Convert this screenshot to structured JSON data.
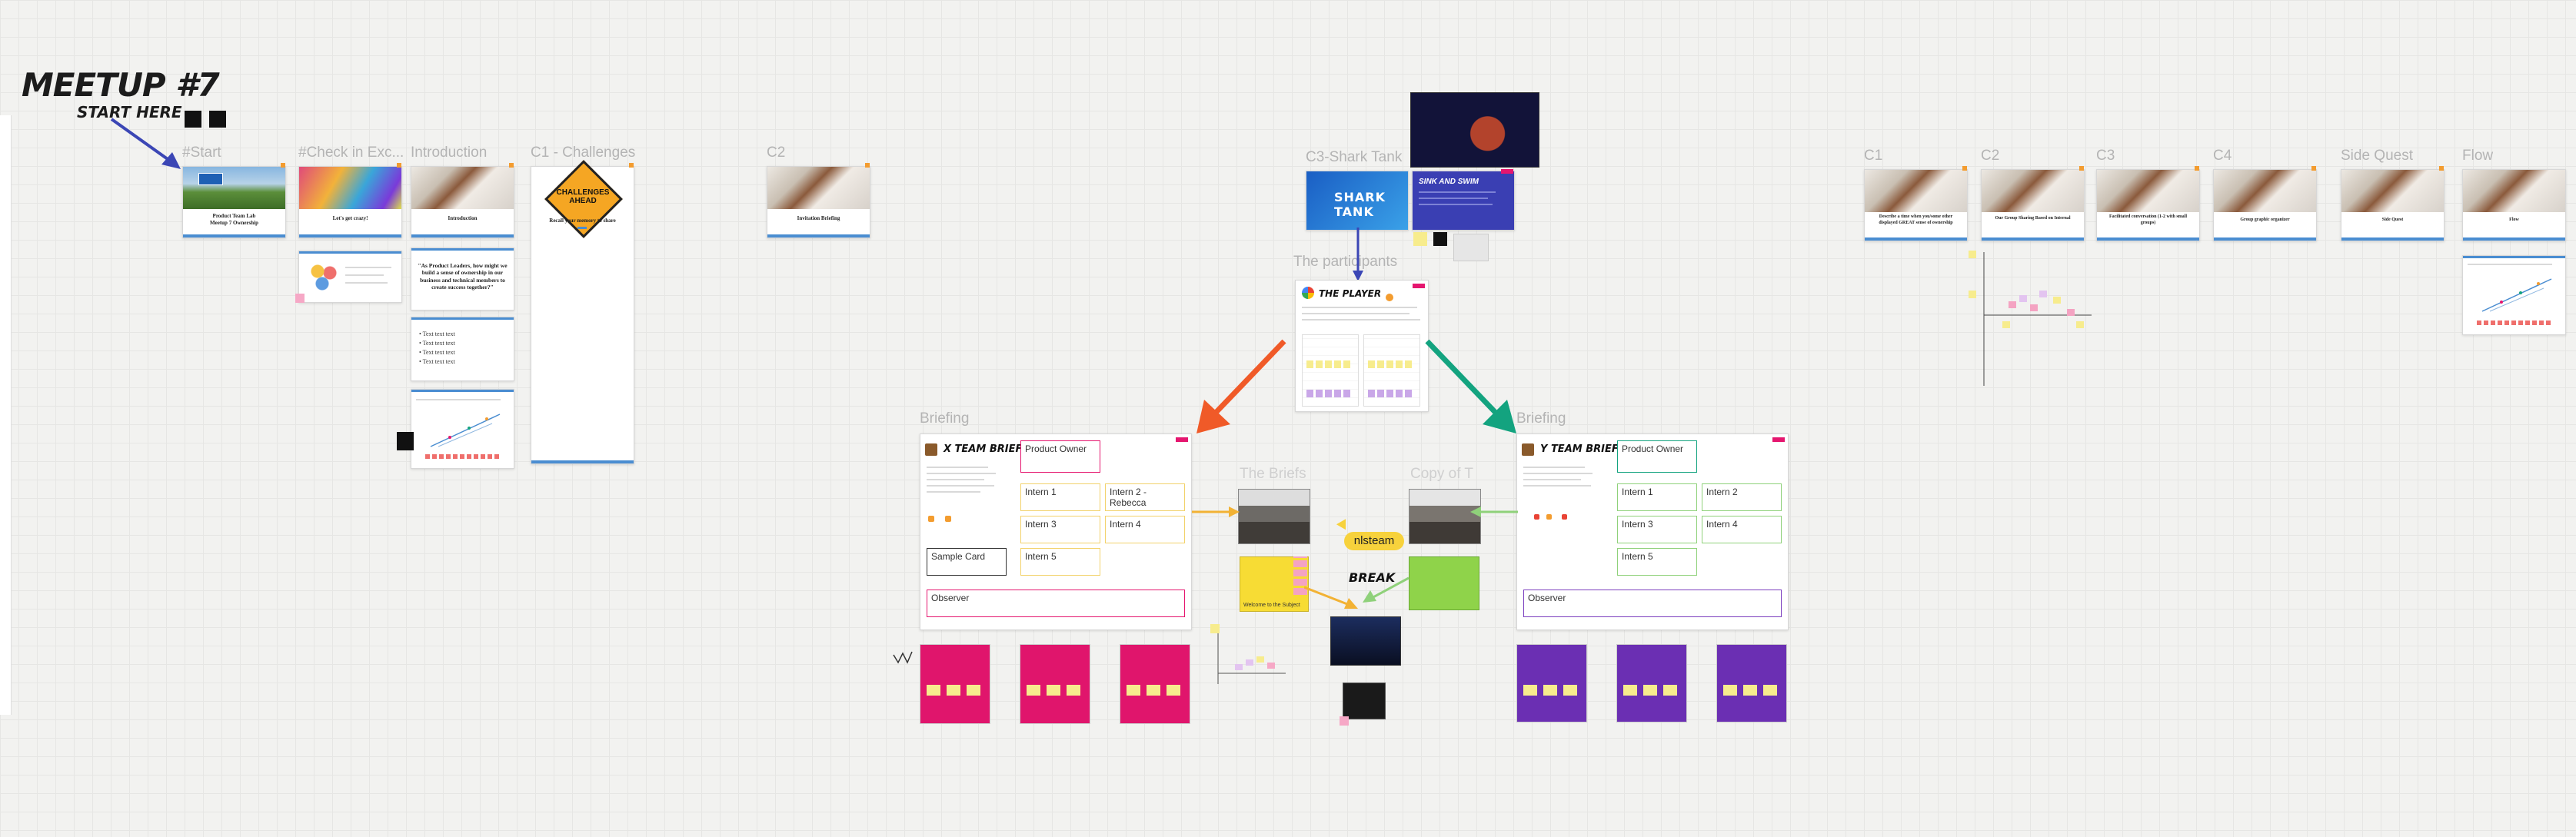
{
  "board": {
    "title": "MEETUP #7",
    "subtitle": "START HERE"
  },
  "frames": {
    "start": "#Start",
    "checkin": "#Check in Exc...",
    "intro": "Introduction",
    "c1_challenges": "C1 - Challenges",
    "c2_left": "C2",
    "shark_tank": "C3-Shark Tank",
    "participants": "The participants",
    "briefing_x": "Briefing",
    "briefing_y": "Briefing",
    "the_briefs": "The Briefs",
    "copy_of": "Copy of T",
    "c1_right": "C1",
    "c2_right": "C2",
    "c3_right": "C3",
    "c4_right": "C4",
    "side_quest": "Side Quest",
    "flow": "Flow"
  },
  "cards": {
    "start_text": "Product Team Lab\nMeetup 7 Ownership",
    "checkin_text": "Let's get crazy!",
    "intro_text": "Introduction",
    "challenges_sign": "CHALLENGES AHEAD",
    "challenges_text": "Recall your memory to share",
    "c2_left_text": "Invitation Briefing",
    "c1_right_text": "Describe a time when you/some other displayed GREAT sense of ownership",
    "c2_right_text": "Our Group Sharing Based on Internal",
    "c3_right_text": "Facilitated conversation (1-2 with small groups)",
    "c4_right_text": "Group graphic organizer",
    "side_quest_text": "Side Quest",
    "flow_text": "Flow",
    "quote": "\"As Product Leaders, how might we build a sense of ownership in our business and technical members to create success together?\"",
    "list_items": [
      "Text text text",
      "Text text text",
      "Text text text",
      "Text text text"
    ],
    "shark_tank_logo": "SHARK TANK",
    "shark_tank_slide": "SINK AND SWIM"
  },
  "player_card": {
    "title": "THE PLAYER"
  },
  "x_team": {
    "title": "X TEAM BRIEF",
    "product_owner": "Product Owner",
    "intern1": "Intern 1",
    "intern2": "Intern 2 - Rebecca",
    "intern3": "Intern 3",
    "intern4": "Intern 4",
    "intern5": "Intern 5",
    "sample_card": "Sample Card",
    "observer": "Observer"
  },
  "y_team": {
    "title": "Y TEAM BRIEF",
    "product_owner": "Product Owner",
    "intern1": "Intern 1",
    "intern2": "Intern 2",
    "intern3": "Intern 3",
    "intern4": "Intern 4",
    "intern5": "Intern 5",
    "observer": "Observer"
  },
  "center": {
    "team_pill": "nlsteam",
    "break_label": "BREAK",
    "yellow_card_caption": "Welcome to the Subject"
  },
  "colors": {
    "accent_blue": "#4a8dd1",
    "arrow_red": "#f05a28",
    "arrow_green": "#13a37f",
    "pink": "#e0156c",
    "purple": "#6b2fb3",
    "sticky_yellow": "#f7ec8d",
    "navy_arrow": "#3b46b5"
  },
  "icons": [
    "arrow-icon",
    "person-icon"
  ]
}
